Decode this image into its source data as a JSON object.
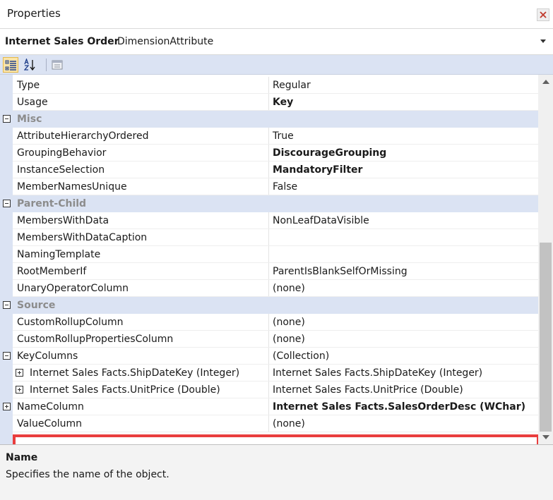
{
  "window": {
    "title": "Properties"
  },
  "object_selector": {
    "name": "Internet Sales Order",
    "type": "DimensionAttribute"
  },
  "toolbar": {
    "buttons": [
      "categorized-icon",
      "alphabetical-icon",
      "property-pages-icon"
    ]
  },
  "grid": {
    "rows": [
      {
        "kind": "prop",
        "label": "Type",
        "value": "Regular",
        "bold": false
      },
      {
        "kind": "prop",
        "label": "Usage",
        "value": "Key",
        "bold": true
      },
      {
        "kind": "cat",
        "label": "Misc"
      },
      {
        "kind": "prop",
        "label": "AttributeHierarchyOrdered",
        "value": "True",
        "bold": false
      },
      {
        "kind": "prop",
        "label": "GroupingBehavior",
        "value": "DiscourageGrouping",
        "bold": true
      },
      {
        "kind": "prop",
        "label": "InstanceSelection",
        "value": "MandatoryFilter",
        "bold": true
      },
      {
        "kind": "prop",
        "label": "MemberNamesUnique",
        "value": "False",
        "bold": false
      },
      {
        "kind": "cat",
        "label": "Parent-Child"
      },
      {
        "kind": "prop",
        "label": "MembersWithData",
        "value": "NonLeafDataVisible",
        "bold": false
      },
      {
        "kind": "prop",
        "label": "MembersWithDataCaption",
        "value": "",
        "bold": false
      },
      {
        "kind": "prop",
        "label": "NamingTemplate",
        "value": "",
        "bold": false
      },
      {
        "kind": "prop",
        "label": "RootMemberIf",
        "value": "ParentIsBlankSelfOrMissing",
        "bold": false
      },
      {
        "kind": "prop",
        "label": "UnaryOperatorColumn",
        "value": "(none)",
        "bold": false
      },
      {
        "kind": "cat",
        "label": "Source"
      },
      {
        "kind": "prop",
        "label": "CustomRollupColumn",
        "value": "(none)",
        "bold": false
      },
      {
        "kind": "prop",
        "label": "CustomRollupPropertiesColumn",
        "value": "(none)",
        "bold": false
      },
      {
        "kind": "prop",
        "label": "KeyColumns",
        "value": "(Collection)",
        "bold": false,
        "expander": "minus"
      },
      {
        "kind": "sub",
        "label": "Internet Sales Facts.ShipDateKey (Integer)",
        "value": "Internet Sales Facts.ShipDateKey (Integer)",
        "bold": false,
        "expander": "plus"
      },
      {
        "kind": "sub",
        "label": "Internet Sales Facts.UnitPrice (Double)",
        "value": "Internet Sales Facts.UnitPrice (Double)",
        "bold": false,
        "expander": "plus"
      },
      {
        "kind": "prop",
        "label": "NameColumn",
        "value": "Internet Sales Facts.SalesOrderDesc (WChar)",
        "bold": true,
        "expander": "plus"
      },
      {
        "kind": "prop",
        "label": "ValueColumn",
        "value": "(none)",
        "bold": false
      }
    ]
  },
  "description": {
    "name": "Name",
    "text": "Specifies the name of the object."
  },
  "colors": {
    "category_bg": "#dbe3f3",
    "highlight": "#e93d3d"
  }
}
